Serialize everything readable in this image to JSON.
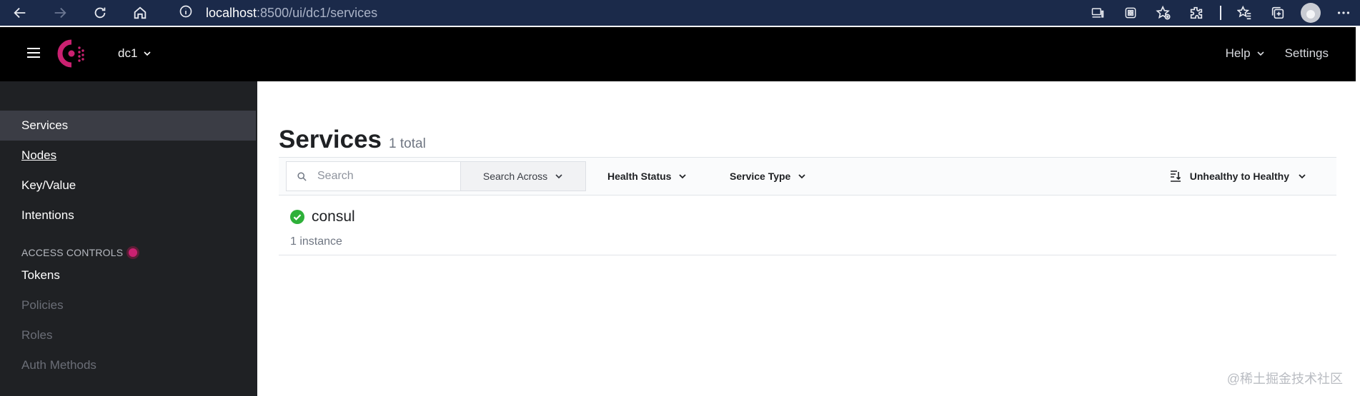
{
  "browser": {
    "url_host": "localhost",
    "url_rest": ":8500/ui/dc1/services"
  },
  "header": {
    "datacenter": "dc1",
    "help_label": "Help",
    "settings_label": "Settings",
    "brand_color": "#ca2171"
  },
  "sidebar": {
    "items": [
      {
        "label": "Services"
      },
      {
        "label": "Nodes"
      },
      {
        "label": "Key/Value"
      },
      {
        "label": "Intentions"
      }
    ],
    "access_controls_heading": "ACCESS CONTROLS",
    "acl_items": [
      {
        "label": "Tokens"
      },
      {
        "label": "Policies"
      },
      {
        "label": "Roles"
      },
      {
        "label": "Auth Methods"
      }
    ]
  },
  "main": {
    "title": "Services",
    "count": "1 total",
    "search": {
      "placeholder": "Search",
      "value": ""
    },
    "search_across_label": "Search Across",
    "health_status_label": "Health Status",
    "service_type_label": "Service Type",
    "sort_label": "Unhealthy to Healthy",
    "services": [
      {
        "name": "consul",
        "instances": "1 instance",
        "health": "passing",
        "health_color": "#2eb039"
      }
    ]
  },
  "watermark": "@稀土掘金技术社区"
}
